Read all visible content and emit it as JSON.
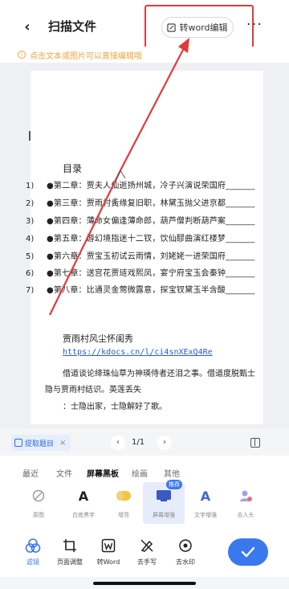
{
  "header": {
    "title": "扫描文件",
    "to_word_label": "转word编辑"
  },
  "hint": {
    "text": "点击文本或图片可以直接编辑哦"
  },
  "document": {
    "toc_title": "目录",
    "toc": [
      {
        "num": "1)",
        "text": "●第二章：贾夫人仙逝扬州城，冷子兴演说荣国府_______"
      },
      {
        "num": "2)",
        "text": "●第三章：贾雨村夤缘复旧职，林黛玉抛父进京都_______"
      },
      {
        "num": "3)",
        "text": "●第四章：薄命女偏逢薄命郎，葫芦僧判断葫芦案_______"
      },
      {
        "num": "4)",
        "text": "●第五章：游幻境指迷十二钗，饮仙醪曲演红楼梦_______"
      },
      {
        "num": "5)",
        "text": "●第六章：贾宝玉初试云雨情，刘姥姥一进荣国府_______"
      },
      {
        "num": "6)",
        "text": "●第七章：送宫花贾琏戏熙凤，宴宁府宝玉会秦钟_______"
      },
      {
        "num": "7)",
        "text": "●第八章：比通灵金莺微露意，探宝钗黛玉半含酸_______"
      }
    ],
    "article_title": "贾雨村风尘怀闺秀",
    "article_link": "https://kdocs.cn/l/ci4snXExQ4Re",
    "article_lines": [
      "借道谈论绛珠仙草为神瑛侍者还泪之事。借道度脱甄士",
      "隐与贾雨村结识。英莲丢失",
      "：士隐出家，士隐解好了歌。"
    ]
  },
  "page_nav": {
    "extract_label": "提取题目",
    "page_count": "1/1"
  },
  "filter_tabs": [
    "最近",
    "文件",
    "屏幕黑板",
    "绘画",
    "其他"
  ],
  "filter_active_tab": "屏幕黑板",
  "filters": [
    {
      "label": "原图",
      "icon": "no-filter-icon"
    },
    {
      "label": "白底黑字",
      "icon": "text-a-icon"
    },
    {
      "label": "增亮",
      "icon": "brighten-icon"
    },
    {
      "label": "屏幕增强",
      "icon": "screen-enhance-icon",
      "badge": "推荐"
    },
    {
      "label": "文字增强",
      "icon": "text-enhance-icon"
    },
    {
      "label": "去人头",
      "icon": "remove-person-icon"
    }
  ],
  "toolbar": [
    {
      "label": "滤镜",
      "icon": "filter-icon"
    },
    {
      "label": "页面调整",
      "icon": "crop-icon"
    },
    {
      "label": "转Word",
      "icon": "word-icon"
    },
    {
      "label": "去手写",
      "icon": "remove-handwriting-icon"
    },
    {
      "label": "去水印",
      "icon": "remove-watermark-icon"
    }
  ],
  "colors": {
    "accent": "#3a78ee",
    "highlight_red": "#e23a3a",
    "hint_orange": "#f2a33b",
    "link_blue": "#2a5bd7"
  }
}
